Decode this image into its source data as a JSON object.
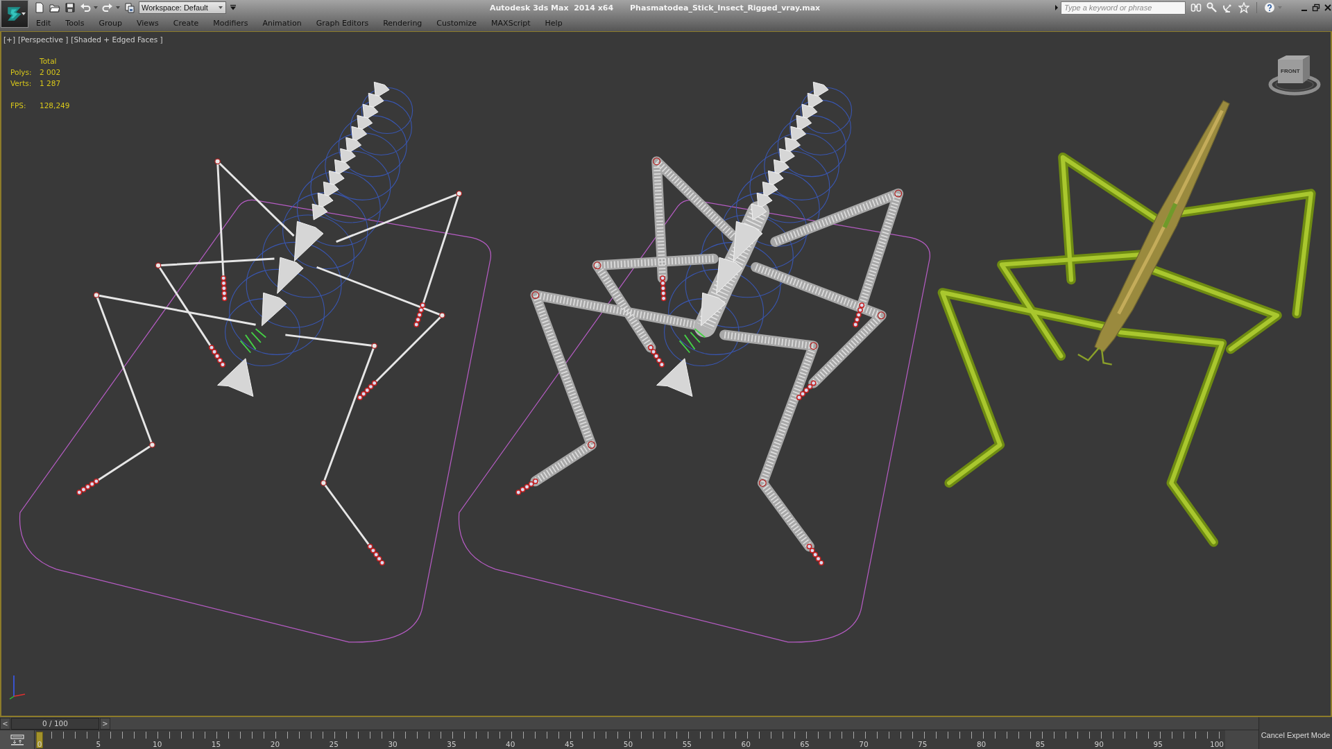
{
  "title_bar": {
    "app_title": "Autodesk 3ds Max  2014 x64",
    "file_name": "Phasmatodea_Stick_Insect_Rigged_vray.max"
  },
  "toolbar": {
    "workspace": "Workspace: Default"
  },
  "search": {
    "placeholder": "Type a keyword or phrase"
  },
  "menu": [
    "Edit",
    "Tools",
    "Group",
    "Views",
    "Create",
    "Modifiers",
    "Animation",
    "Graph Editors",
    "Rendering",
    "Customize",
    "MAXScript",
    "Help"
  ],
  "viewport": {
    "labels": [
      "[+]",
      "[Perspective ]",
      "[Shaded + Edged Faces ]"
    ],
    "stats": {
      "header": "Total",
      "rows": [
        {
          "label": "Polys:",
          "value": "2 002"
        },
        {
          "label": "Verts:",
          "value": "1 287"
        }
      ],
      "fps": {
        "label": "FPS:",
        "value": "128,249"
      }
    },
    "view_cube": {
      "face_label": "FRONT"
    }
  },
  "time_slider": {
    "prev": "<",
    "reading": "0 / 100",
    "next": ">",
    "level": 0
  },
  "track_bar": {
    "ticks": [
      "0",
      "5",
      "10",
      "15",
      "20",
      "25",
      "30",
      "35",
      "40",
      "45",
      "50",
      "55",
      "60",
      "65",
      "70",
      "75",
      "80",
      "85",
      "90",
      "95",
      "100"
    ]
  },
  "expert_mode": {
    "button": "Cancel Expert Mode"
  }
}
